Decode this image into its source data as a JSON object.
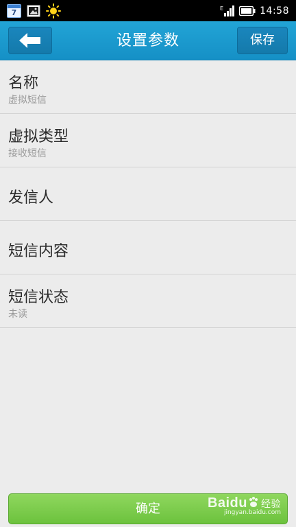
{
  "status_bar": {
    "calendar_day": "7",
    "network_label": "E",
    "time": "14:58",
    "icons": [
      "calendar-icon",
      "picture-icon",
      "sun-icon",
      "signal-icon",
      "battery-icon"
    ]
  },
  "header": {
    "title": "设置参数",
    "save_label": "保存",
    "back_icon": "back-arrow-icon",
    "accent_color": "#1a9ad0"
  },
  "settings": {
    "items": [
      {
        "label": "名称",
        "value": "虚拟短信"
      },
      {
        "label": "虚拟类型",
        "value": "接收短信"
      },
      {
        "label": "发信人",
        "value": ""
      },
      {
        "label": "短信内容",
        "value": ""
      },
      {
        "label": "短信状态",
        "value": "未读"
      }
    ]
  },
  "footer": {
    "confirm_label": "确定",
    "confirm_color": "#7ccb4a"
  },
  "watermark": {
    "brand": "Baidu",
    "brand_cn": "经验",
    "url": "jingyan.baidu.com"
  }
}
